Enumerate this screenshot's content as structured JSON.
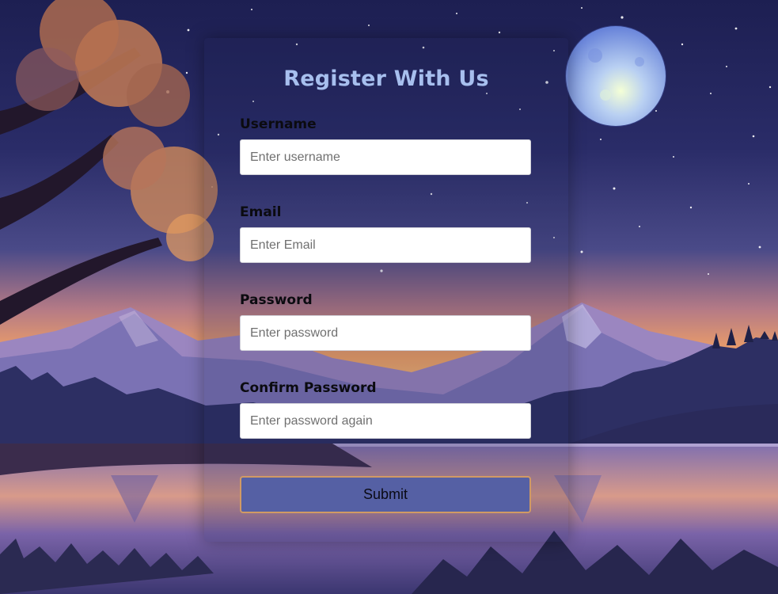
{
  "form": {
    "title": "Register With Us",
    "username": {
      "label": "Username",
      "placeholder": "Enter username",
      "value": ""
    },
    "email": {
      "label": "Email",
      "placeholder": "Enter Email",
      "value": ""
    },
    "password": {
      "label": "Password",
      "placeholder": "Enter password",
      "value": ""
    },
    "confirm_password": {
      "label": "Confirm Password",
      "placeholder": "Enter password again",
      "value": ""
    },
    "submit_label": "Submit"
  },
  "colors": {
    "title": "#a7bfee",
    "submit_bg": "#5560a4",
    "submit_border": "#d19a64"
  },
  "background": {
    "icons": [
      "moon-icon",
      "tree-icon",
      "mountain-icon",
      "lake-icon",
      "stars-icon"
    ]
  }
}
